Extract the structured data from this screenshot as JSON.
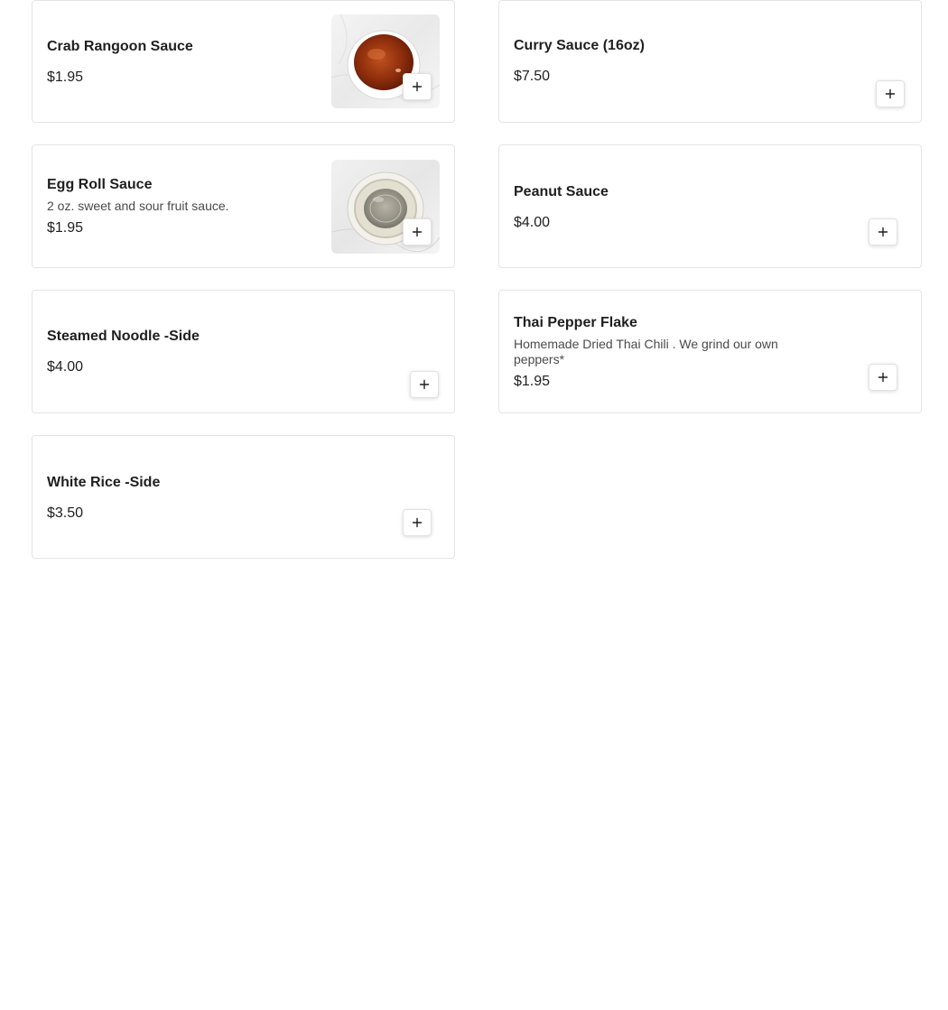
{
  "menu_items": [
    {
      "name": "Crab Rangoon Sauce",
      "description": "",
      "price": "$1.95",
      "has_image": true,
      "image": "sweet-chili-sauce-cup"
    },
    {
      "name": "Curry Sauce (16oz)",
      "description": "",
      "price": "$7.50",
      "has_image": false
    },
    {
      "name": "Egg Roll Sauce",
      "description": "2 oz. sweet and sour fruit sauce.",
      "price": "$1.95",
      "has_image": true,
      "image": "sauce-cup-with-lid"
    },
    {
      "name": "Peanut Sauce",
      "description": "",
      "price": "$4.00",
      "has_image": false
    },
    {
      "name": "Steamed Noodle -Side",
      "description": "",
      "price": "$4.00",
      "has_image": false
    },
    {
      "name": "Thai Pepper Flake",
      "description": "Homemade Dried Thai Chili . We grind our own peppers*",
      "price": "$1.95",
      "has_image": false
    },
    {
      "name": "White Rice -Side",
      "description": "",
      "price": "$3.50",
      "has_image": false
    }
  ],
  "add_icon": "plus-icon",
  "colors": {
    "card_border": "#e4e4e4",
    "text_primary": "#1f1f1f",
    "text_secondary": "#4a4a4a"
  }
}
